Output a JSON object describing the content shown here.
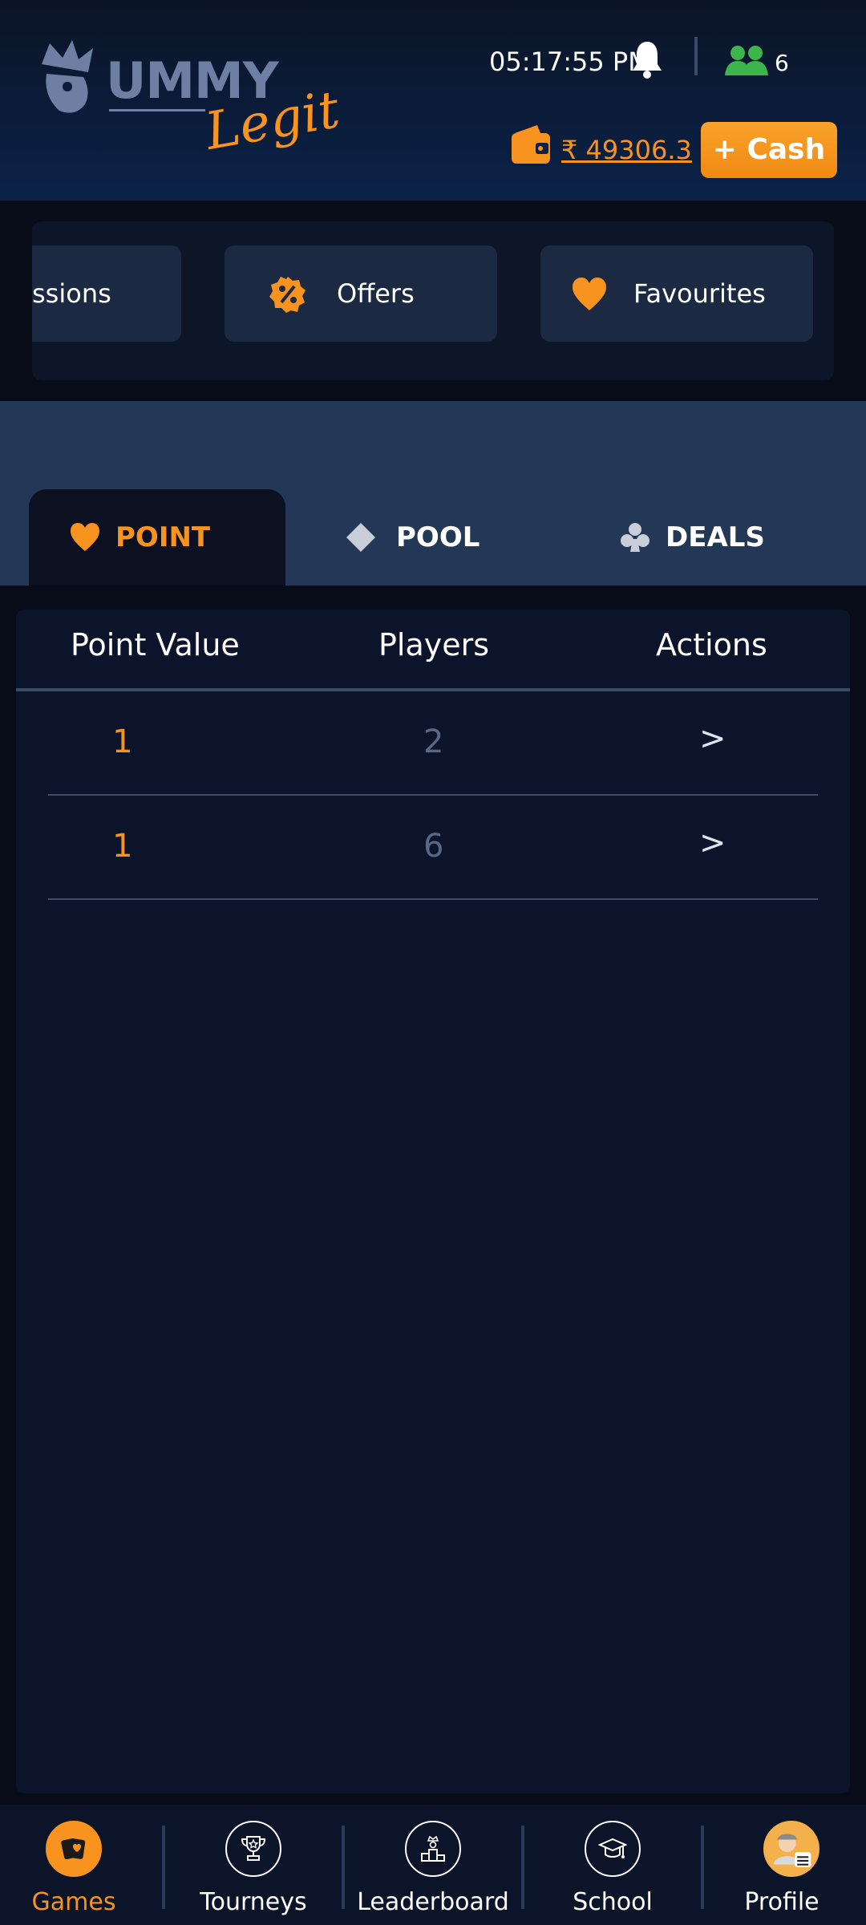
{
  "header": {
    "logo_text": "UMMY",
    "logo_script": "Legit",
    "time": "05:17:55 PM",
    "friends_count": "6",
    "balance": "₹ 49306.3",
    "cash_button": "+ Cash"
  },
  "quick_menu": {
    "items": [
      {
        "label": "ssions",
        "icon": "none"
      },
      {
        "label": "Offers",
        "icon": "percent-badge-icon"
      },
      {
        "label": "Favourites",
        "icon": "heart-icon"
      }
    ]
  },
  "tabs": [
    {
      "label": "POINT",
      "icon": "heart-icon",
      "active": true
    },
    {
      "label": "POOL",
      "icon": "diamond-icon",
      "active": false
    },
    {
      "label": "DEALS",
      "icon": "club-icon",
      "active": false
    }
  ],
  "table": {
    "headers": [
      "Point Value",
      "Players",
      "Actions"
    ],
    "rows": [
      {
        "point_value": "1",
        "players": "2",
        "action": ">"
      },
      {
        "point_value": "1",
        "players": "6",
        "action": ">"
      }
    ]
  },
  "bottom_nav": [
    {
      "label": "Games",
      "icon": "cards-icon",
      "active": true
    },
    {
      "label": "Tourneys",
      "icon": "trophy-icon",
      "active": false
    },
    {
      "label": "Leaderboard",
      "icon": "podium-icon",
      "active": false
    },
    {
      "label": "School",
      "icon": "graduation-cap-icon",
      "active": false
    },
    {
      "label": "Profile",
      "icon": "avatar",
      "active": false
    }
  ],
  "colors": {
    "accent": "#f7931e",
    "header_bg": "#0b2248",
    "tabs_band": "#233856",
    "table_bg": "#0b142a",
    "friends_green": "#3cb54a"
  }
}
